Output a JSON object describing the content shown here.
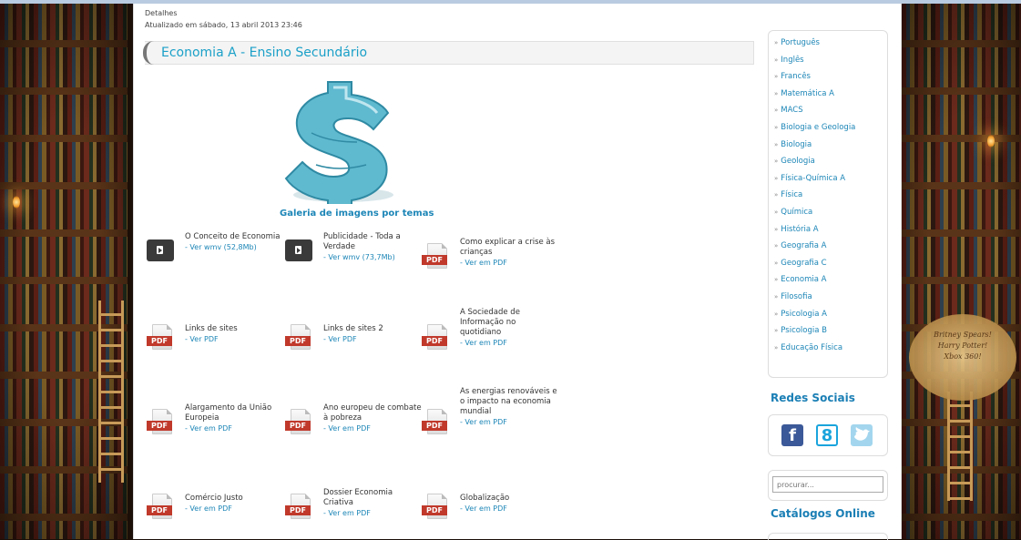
{
  "article": {
    "details_label": "Detalhes",
    "updated": "Atualizado em sábado, 13 abril 2013 23:46",
    "title": "Economia A - Ensino Secundário",
    "gallery_link": "Galeria de imagens por temas"
  },
  "documents": [
    {
      "icon": "video-icon",
      "title": "O Conceito de Economia",
      "link": "- Ver wmv (52,8Mb)"
    },
    {
      "icon": "video-icon",
      "title": "Publicidade - Toda a Verdade",
      "link": "- Ver wmv (73,7Mb)"
    },
    {
      "icon": "pdf-icon",
      "title": "Como explicar a crise às crianças",
      "link": "- Ver em PDF"
    },
    {
      "icon": "pdf-icon",
      "title": "Links de sites",
      "link": "- Ver PDF"
    },
    {
      "icon": "pdf-icon",
      "title": "Links de sites 2",
      "link": "- Ver PDF"
    },
    {
      "icon": "pdf-icon",
      "title": "A Sociedade de Informação no quotidiano",
      "link": "- Ver em PDF"
    },
    {
      "icon": "pdf-icon",
      "title": "Alargamento da União Europeia",
      "link": "- Ver em PDF"
    },
    {
      "icon": "pdf-icon",
      "title": "Ano europeu de combate à pobreza",
      "link": "- Ver em PDF"
    },
    {
      "icon": "pdf-icon",
      "title": "As energias renováveis e o impacto na economia mundial",
      "link": "- Ver em PDF"
    },
    {
      "icon": "pdf-icon",
      "title": "Comércio Justo",
      "link": "- Ver em PDF"
    },
    {
      "icon": "pdf-icon",
      "title": "Dossier Economia Criativa",
      "link": "- Ver em PDF"
    },
    {
      "icon": "pdf-icon",
      "title": "Globalização",
      "link": "- Ver em PDF"
    }
  ],
  "pdf_tag": "PDF",
  "sidebar": {
    "separator": "»",
    "subjects": [
      "Português",
      "Inglês",
      "Francês",
      "Matemática A",
      "MACS",
      "Biologia e Geologia",
      "Biologia",
      "Geologia",
      "Física-Química A",
      "Física",
      "Química",
      "História A",
      "Geografia A",
      "Geografia C",
      "Economia A",
      "Filosofia",
      "Psicologia A",
      "Psicologia B",
      "Educação Física"
    ],
    "social_heading": "Redes Sociais",
    "social": {
      "facebook": "f",
      "google": "8",
      "twitter": "t"
    },
    "search_placeholder": "procurar...",
    "catalog_heading": "Catálogos Online"
  },
  "decor": {
    "sign_lines": [
      "Britney Spears!",
      "Harry Potter!",
      "Xbox 360!"
    ]
  },
  "colors": {
    "accent": "#1ba0c8",
    "link": "#1d86b7",
    "pdf_red": "#c0392b"
  }
}
